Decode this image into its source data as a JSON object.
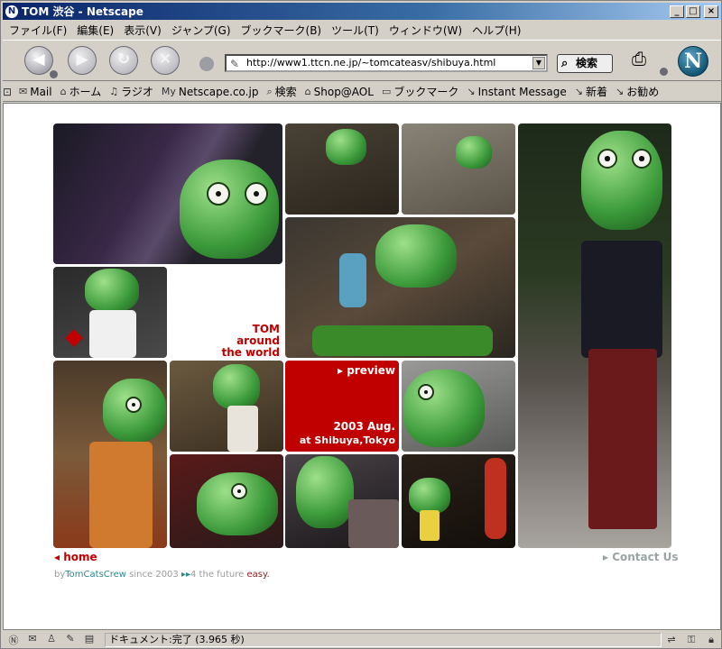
{
  "window": {
    "title": "TOM 渋谷 - Netscape",
    "app_icon": "N"
  },
  "menu": [
    "ファイル(F)",
    "編集(E)",
    "表示(V)",
    "ジャンプ(G)",
    "ブックマーク(B)",
    "ツール(T)",
    "ウィンドウ(W)",
    "ヘルプ(H)"
  ],
  "nav": {
    "url": "http://www1.ttcn.ne.jp/~tomcateasv/shibuya.html",
    "search_label": "検索",
    "logo": "N"
  },
  "personal_toolbar": [
    {
      "icon": "mail-icon",
      "label": "Mail"
    },
    {
      "icon": "home-icon",
      "label": "ホーム"
    },
    {
      "icon": "radio-icon",
      "label": "ラジオ"
    },
    {
      "icon": "my-icon",
      "label": "Netscape.co.jp"
    },
    {
      "icon": "search-icon",
      "label": "検索"
    },
    {
      "icon": "shop-icon",
      "label": "Shop@AOL"
    },
    {
      "icon": "folder-icon",
      "label": "ブックマーク"
    },
    {
      "icon": "bookmark-icon",
      "label": "Instant Message"
    },
    {
      "icon": "bookmark-icon",
      "label": "新着"
    },
    {
      "icon": "bookmark-icon",
      "label": "お勧め"
    }
  ],
  "page": {
    "tagline_line1": "TOM",
    "tagline_line2": "around",
    "tagline_line3": "the world",
    "preview_label": "preview",
    "event_date": "2003 Aug.",
    "event_place": "at Shibuya,Tokyo",
    "home_link": "home",
    "contact_link": "Contact Us",
    "credits": {
      "by": "by",
      "crew": "TomCatsCrew",
      "since": "since 2003",
      "future": "4 the future",
      "easy": "easy."
    }
  },
  "status": {
    "text": "ドキュメント:完了 (3.965 秒)"
  }
}
